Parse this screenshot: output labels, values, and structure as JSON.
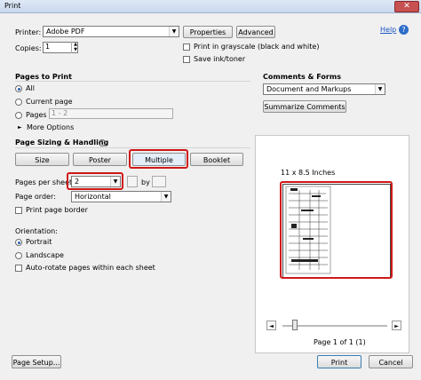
{
  "window": {
    "title": "Print",
    "close": "✕"
  },
  "printer": {
    "label": "Printer:",
    "value": "Adobe PDF",
    "properties": "Properties",
    "advanced": "Advanced",
    "help": "Help"
  },
  "copies": {
    "label": "Copies:",
    "value": "1"
  },
  "options": {
    "grayscale": "Print in grayscale (black and white)",
    "save_ink": "Save ink/toner"
  },
  "pages_to_print": {
    "title": "Pages to Print",
    "all": "All",
    "current": "Current page",
    "pages": "Pages",
    "pages_value": "1 - 2",
    "more": "More Options"
  },
  "sizing": {
    "title": "Page Sizing & Handling",
    "tabs": [
      "Size",
      "Poster",
      "Multiple",
      "Booklet"
    ],
    "pages_per_sheet_label": "Pages per sheet:",
    "pages_per_sheet_value": "2",
    "by": "by",
    "page_order_label": "Page order:",
    "page_order_value": "Horizontal",
    "border": "Print page border"
  },
  "orientation": {
    "title": "Orientation:",
    "portrait": "Portrait",
    "landscape": "Landscape",
    "auto_rotate": "Auto-rotate pages within each sheet"
  },
  "comments": {
    "title": "Comments & Forms",
    "value": "Document and Markups",
    "summarize": "Summarize Comments"
  },
  "preview": {
    "size": "11 x 8.5 Inches",
    "page_info": "Page 1 of 1 (1)",
    "prev": "◄",
    "next": "►"
  },
  "footer": {
    "page_setup": "Page Setup...",
    "print": "Print",
    "cancel": "Cancel"
  }
}
